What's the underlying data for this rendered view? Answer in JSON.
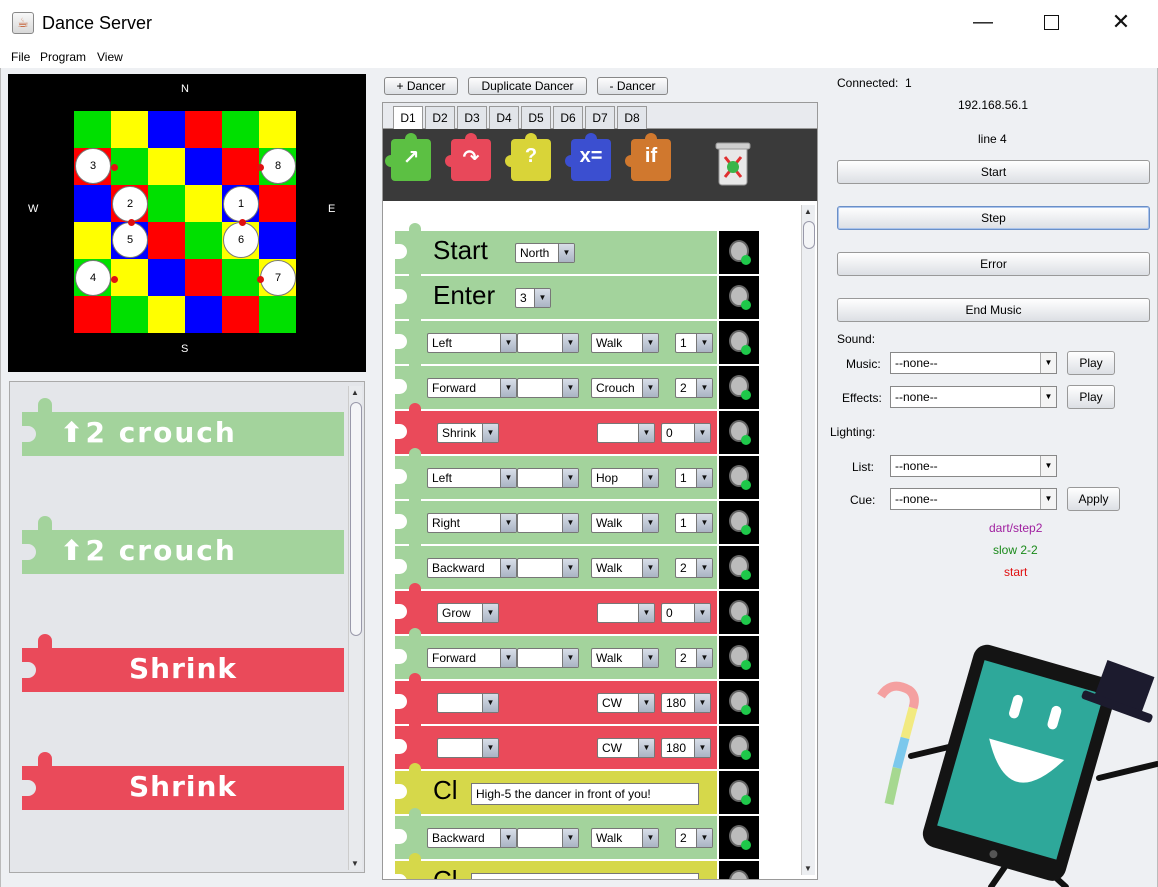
{
  "window": {
    "title": "Dance Server",
    "controls": {
      "minimize": "—",
      "close": "✕"
    }
  },
  "menu": [
    "File",
    "Program",
    "View"
  ],
  "floor": {
    "compass": {
      "north": "N",
      "south": "S",
      "west": "W",
      "east": "E"
    },
    "grid_colors": [
      [
        "#00e000",
        "#ffff00",
        "#0000ff",
        "#ff0000",
        "#00e000",
        "#ffff00"
      ],
      [
        "#ff0000",
        "#00e000",
        "#ffff00",
        "#0000ff",
        "#ff0000",
        "#00e000"
      ],
      [
        "#0000ff",
        "#ff0000",
        "#00e000",
        "#ffff00",
        "#0000ff",
        "#ff0000"
      ],
      [
        "#ffff00",
        "#0000ff",
        "#ff0000",
        "#00e000",
        "#ffff00",
        "#0000ff"
      ],
      [
        "#00e000",
        "#ffff00",
        "#0000ff",
        "#ff0000",
        "#00e000",
        "#ffff00"
      ],
      [
        "#ff0000",
        "#00e000",
        "#ffff00",
        "#0000ff",
        "#ff0000",
        "#00e000"
      ]
    ],
    "dancers": [
      "3",
      "2",
      "1",
      "8",
      "5",
      "6",
      "4",
      "7"
    ]
  },
  "palette_blocks": [
    {
      "text": "⬆2 crouch",
      "color": "#a3d39c"
    },
    {
      "text": "⬆2 crouch",
      "color": "#a3d39c"
    },
    {
      "text": "Shrink",
      "color": "#ea4a5a"
    },
    {
      "text": "Shrink",
      "color": "#ea4a5a"
    }
  ],
  "dancer_buttons": {
    "add": "+ Dancer",
    "duplicate": "Duplicate Dancer",
    "remove": "- Dancer"
  },
  "tabs": [
    "D1",
    "D2",
    "D3",
    "D4",
    "D5",
    "D6",
    "D7",
    "D8"
  ],
  "active_tab": "D1",
  "toolbox": [
    {
      "name": "move-tool-icon",
      "glyph": "↗",
      "color": "#5cc043"
    },
    {
      "name": "turn-tool-icon",
      "glyph": "↷",
      "color": "#e8485a"
    },
    {
      "name": "question-tool-icon",
      "glyph": "?",
      "color": "#d9d438"
    },
    {
      "name": "variable-tool-icon",
      "glyph": "x=",
      "color": "#3b4fd0"
    },
    {
      "name": "if-tool-icon",
      "glyph": "if",
      "color": "#d0782e"
    }
  ],
  "colors": {
    "green": "#a3d39c",
    "red": "#ea4a5a",
    "yellow": "#d6d84a"
  },
  "program_rows": [
    {
      "color": "green",
      "keyword": "Start",
      "fields": [
        "North"
      ]
    },
    {
      "color": "green",
      "keyword": "Enter",
      "fields": [
        "3"
      ]
    },
    {
      "color": "green",
      "fields": [
        "Left",
        "",
        "Walk",
        "1"
      ]
    },
    {
      "color": "green",
      "fields": [
        "Forward",
        "",
        "Crouch",
        "2"
      ]
    },
    {
      "color": "red",
      "fields": [
        "Shrink",
        "",
        "0"
      ]
    },
    {
      "color": "green",
      "fields": [
        "Left",
        "",
        "Hop",
        "1"
      ]
    },
    {
      "color": "green",
      "fields": [
        "Right",
        "",
        "Walk",
        "1"
      ]
    },
    {
      "color": "green",
      "fields": [
        "Backward",
        "",
        "Walk",
        "2"
      ]
    },
    {
      "color": "red",
      "fields": [
        "Grow",
        "",
        "0"
      ]
    },
    {
      "color": "green",
      "fields": [
        "Forward",
        "",
        "Walk",
        "2"
      ]
    },
    {
      "color": "red",
      "fields": [
        "",
        "CW",
        "180"
      ]
    },
    {
      "color": "red",
      "fields": [
        "",
        "CW",
        "180"
      ]
    },
    {
      "color": "yellow",
      "keyword": "Cl",
      "text": "High-5 the dancer in front of you!"
    },
    {
      "color": "green",
      "fields": [
        "Backward",
        "",
        "Walk",
        "2"
      ]
    },
    {
      "color": "yellow",
      "keyword": "Cl",
      "text": ""
    }
  ],
  "status": {
    "connected_label": "Connected:",
    "connected_count": "1",
    "ip": "192.168.56.1",
    "line": "line 4"
  },
  "controls": {
    "start": "Start",
    "step": "Step",
    "error": "Error",
    "end_music": "End Music"
  },
  "sound": {
    "label": "Sound:",
    "music_label": "Music:",
    "music_value": "--none--",
    "effects_label": "Effects:",
    "effects_value": "--none--",
    "play": "Play"
  },
  "lighting": {
    "label": "Lighting:",
    "list_label": "List:",
    "list_value": "--none--",
    "cue_label": "Cue:",
    "cue_value": "--none--",
    "apply": "Apply"
  },
  "cues": [
    {
      "text": "dart/step2",
      "color": "#a020a0"
    },
    {
      "text": "slow 2-2",
      "color": "#1a8a1a"
    },
    {
      "text": "start",
      "color": "#e01010"
    }
  ]
}
